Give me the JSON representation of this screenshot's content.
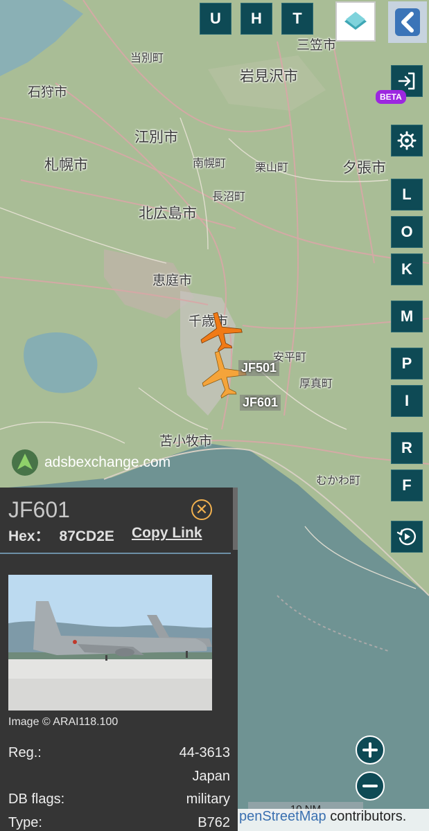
{
  "toolbar": {
    "top_buttons": [
      "U",
      "H",
      "T"
    ],
    "side_buttons": [
      "L",
      "O",
      "K",
      "M",
      "P",
      "I",
      "R",
      "F"
    ],
    "beta_badge": "BETA"
  },
  "map": {
    "labels": [
      "石狩市",
      "当別町",
      "三笠市",
      "岩見沢市",
      "江別市",
      "南幌町",
      "栗山町",
      "夕張市",
      "札幌市",
      "北広島市",
      "長沼町",
      "恵庭市",
      "千歳市",
      "安平町",
      "厚真町",
      "苫小牧市",
      "むかわ町"
    ],
    "watermark": "adsbexchange.com",
    "scale": "10 NM",
    "attribution_link": "penStreetMap",
    "attribution_rest": " contributors."
  },
  "aircraft": [
    {
      "callsign": "JF501",
      "color": "#f07a16"
    },
    {
      "callsign": "JF601",
      "color": "#f5a43a"
    }
  ],
  "panel": {
    "callsign": "JF601",
    "hex_label": "Hex：",
    "hex_value": "87CD2E",
    "copy_link": "Copy Link",
    "image_credit": "Image © ARAI118.100",
    "fields": [
      {
        "key": "Reg.:",
        "value": "44-3613"
      },
      {
        "key": "",
        "value": "Japan"
      },
      {
        "key": "DB flags:",
        "value": "military"
      },
      {
        "key": "Type:",
        "value": "B762"
      }
    ]
  },
  "colors": {
    "button_bg": "#0e4a55",
    "panel_bg": "#353535",
    "close_accent": "#f2b14f",
    "beta_bg": "#9c27e0"
  }
}
